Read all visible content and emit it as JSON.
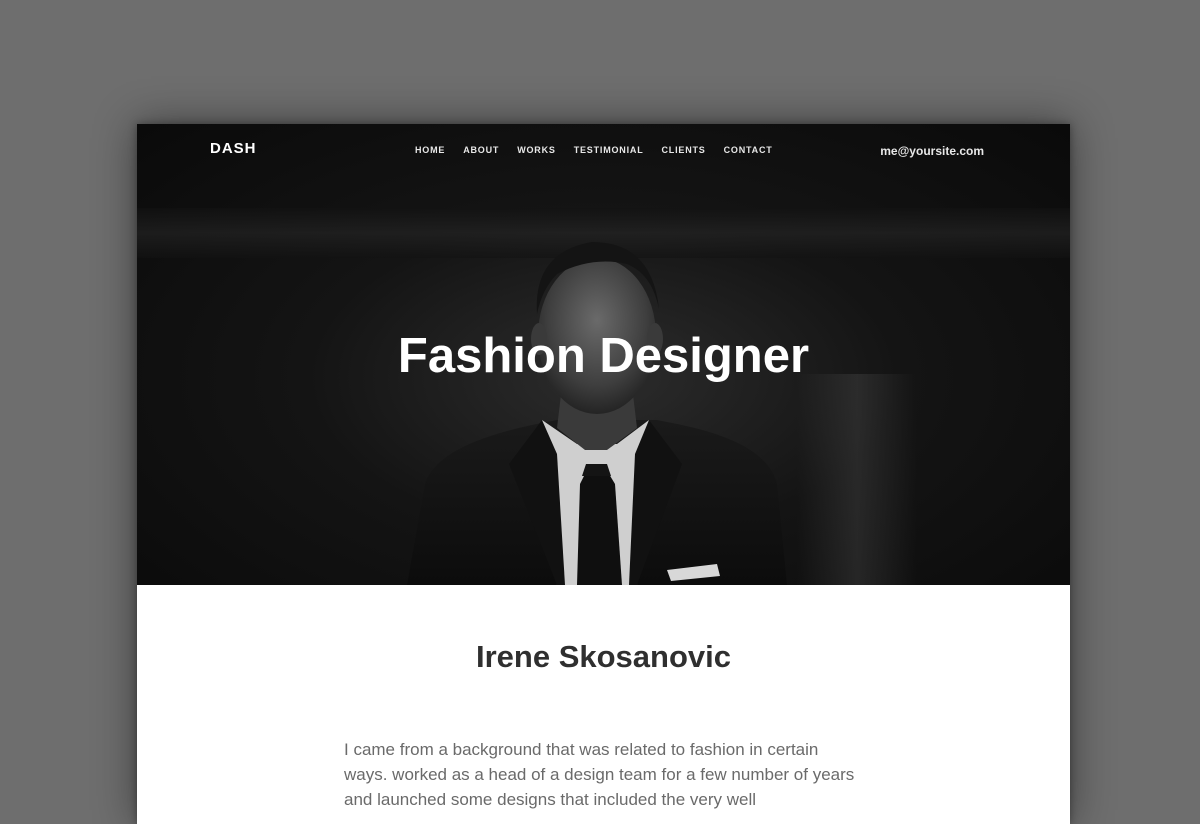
{
  "header": {
    "logo": "DASH",
    "nav": [
      "HOME",
      "ABOUT",
      "WORKS",
      "TESTIMONIAL",
      "CLIENTS",
      "CONTACT"
    ],
    "email": "me@yoursite.com"
  },
  "hero": {
    "title": "Fashion Designer"
  },
  "profile": {
    "name": "Irene Skosanovic",
    "bio": "I came from a background that was related to fashion in certain ways. worked as a head of a design team for a few number of years and launched some designs that included the very well"
  }
}
